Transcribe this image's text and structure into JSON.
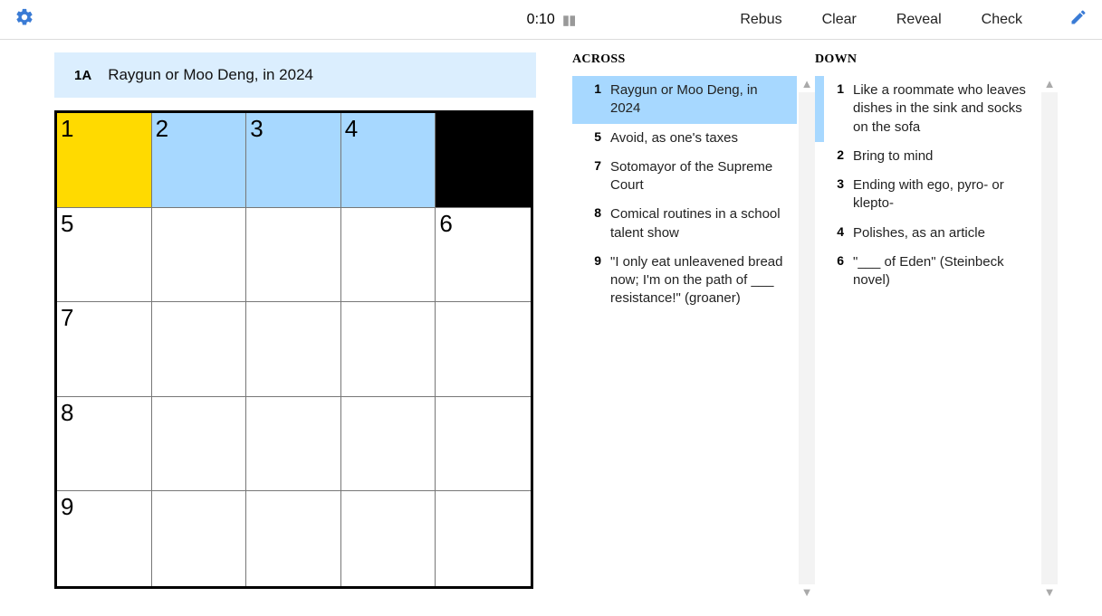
{
  "toolbar": {
    "timer": "0:10",
    "buttons": {
      "rebus": "Rebus",
      "clear": "Clear",
      "reveal": "Reveal",
      "check": "Check"
    }
  },
  "current_clue": {
    "label": "1A",
    "text": "Raygun or Moo Deng, in 2024"
  },
  "grid": {
    "rows": 5,
    "cols": 5,
    "cells": [
      {
        "num": "1",
        "state": "sel"
      },
      {
        "num": "2",
        "state": "hl"
      },
      {
        "num": "3",
        "state": "hl"
      },
      {
        "num": "4",
        "state": "hl"
      },
      {
        "state": "black"
      },
      {
        "num": "5"
      },
      {},
      {},
      {},
      {
        "num": "6"
      },
      {
        "num": "7"
      },
      {},
      {},
      {},
      {},
      {
        "num": "8"
      },
      {},
      {},
      {},
      {},
      {
        "num": "9"
      },
      {},
      {},
      {},
      {}
    ]
  },
  "across": {
    "title": "ACROSS",
    "clues": [
      {
        "n": "1",
        "t": "Raygun or Moo Deng, in 2024",
        "active": true
      },
      {
        "n": "5",
        "t": "Avoid, as one's taxes"
      },
      {
        "n": "7",
        "t": "Sotomayor of the Supreme Court"
      },
      {
        "n": "8",
        "t": "Comical routines in a school talent show"
      },
      {
        "n": "9",
        "t": "\"I only eat unleavened bread now; I'm on the path of ___ resistance!\" (groaner)"
      }
    ]
  },
  "down": {
    "title": "DOWN",
    "clues": [
      {
        "n": "1",
        "t": "Like a roommate who leaves dishes in the sink and socks on the sofa",
        "related": true
      },
      {
        "n": "2",
        "t": "Bring to mind"
      },
      {
        "n": "3",
        "t": "Ending with ego, pyro- or klepto-"
      },
      {
        "n": "4",
        "t": "Polishes, as an article"
      },
      {
        "n": "6",
        "t": "\"___ of Eden\" (Steinbeck novel)"
      }
    ]
  }
}
